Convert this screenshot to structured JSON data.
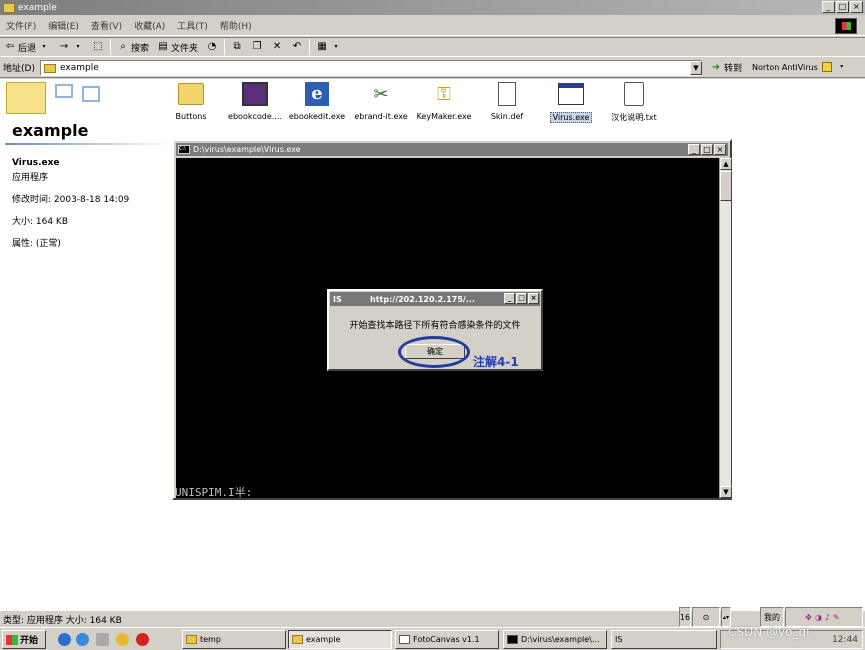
{
  "window": {
    "title": "example",
    "controls": [
      "_",
      "□",
      "×"
    ]
  },
  "menu": [
    "文件(F)",
    "编辑(E)",
    "查看(V)",
    "收藏(A)",
    "工具(T)",
    "帮助(H)"
  ],
  "toolbar": {
    "back": "后退",
    "forward": "→",
    "search": "搜索",
    "folders": "文件夹"
  },
  "address": {
    "label": "地址(D)",
    "value": "example",
    "go": "转到",
    "norton": "Norton AntiVirus"
  },
  "left_panel": {
    "title": "example",
    "file_name": "Virus.exe",
    "file_type": "应用程序",
    "modified": "修改时间: 2003-8-18 14:09",
    "size": "大小: 164 KB",
    "attributes": "属性: (正常)"
  },
  "files": [
    {
      "label": "Buttons",
      "icon": "folder-icon"
    },
    {
      "label": "ebookcode....",
      "icon": "monitor-app-icon"
    },
    {
      "label": "ebookedit.exe",
      "icon": "ebook-e-icon"
    },
    {
      "label": "ebrand-it.exe",
      "icon": "tools-icon"
    },
    {
      "label": "KeyMaker.exe",
      "icon": "key-icon"
    },
    {
      "label": "Skin.def",
      "icon": "document-icon"
    },
    {
      "label": "Virus.exe",
      "icon": "window-app-icon"
    },
    {
      "label": "汉化说明.txt",
      "icon": "text-file-icon"
    }
  ],
  "console": {
    "title": "D:\\virus\\example\\Virus.exe",
    "prompt": "UNISPIM.I半:"
  },
  "dialog": {
    "title_left": "IS",
    "title_url": "http://202.120.2.175/...",
    "message": "开始查找本路径下所有符合感染条件的文件",
    "ok": "确定"
  },
  "annotation": "注解4-1",
  "status": {
    "text": "类型: 应用程序 大小: 164 KB",
    "right_num": "16",
    "right_label": "我的"
  },
  "taskbar": {
    "start": "开始",
    "tasks": [
      "temp",
      "example",
      "FotoCanvas v1.1",
      "D:\\virus\\example\\...",
      "IS"
    ],
    "clock": "12:44"
  },
  "watermark": "CSDN @yo_ql"
}
